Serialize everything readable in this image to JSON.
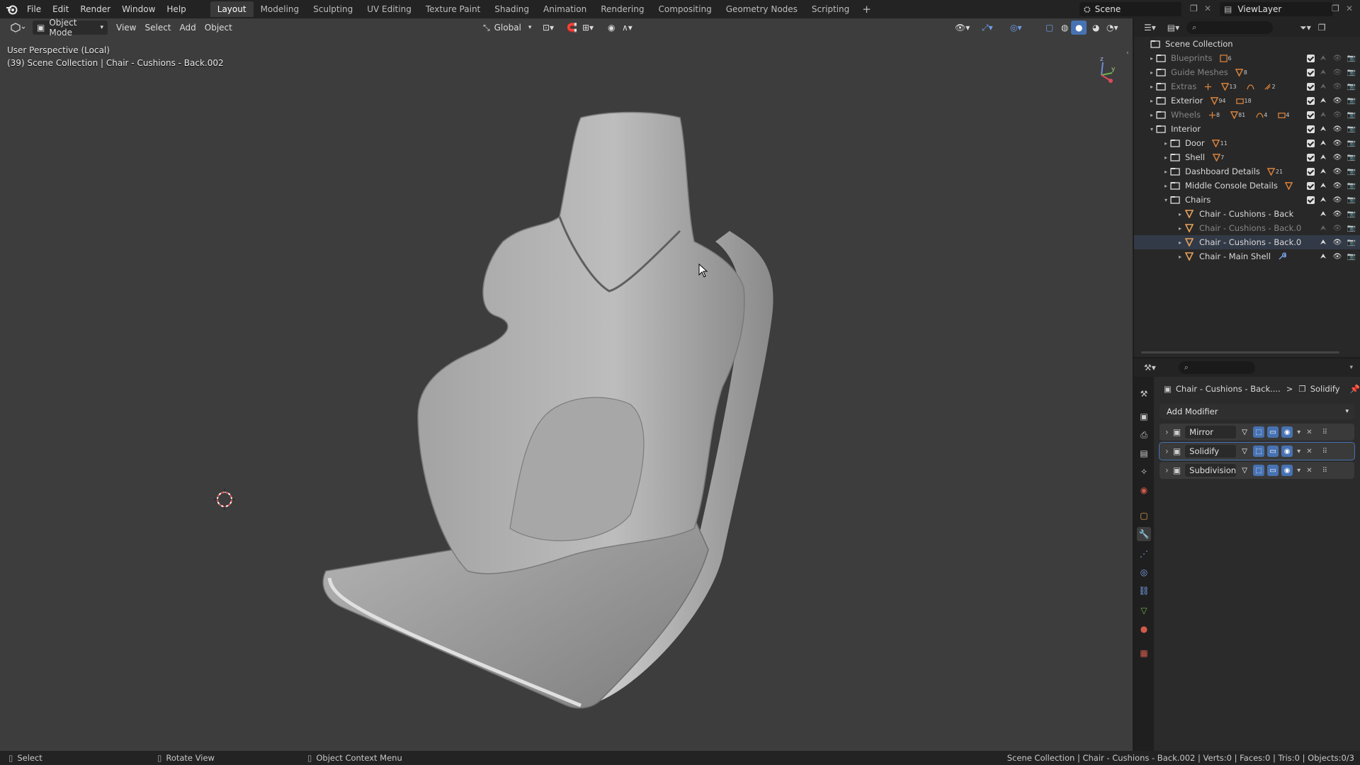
{
  "top_menu": {
    "items": [
      "File",
      "Edit",
      "Render",
      "Window",
      "Help"
    ],
    "workspaces": [
      "Layout",
      "Modeling",
      "Sculpting",
      "UV Editing",
      "Texture Paint",
      "Shading",
      "Animation",
      "Rendering",
      "Compositing",
      "Geometry Nodes",
      "Scripting"
    ],
    "active_workspace": "Layout",
    "add_label": "+",
    "scene_name": "Scene",
    "view_layer": "ViewLayer"
  },
  "viewport": {
    "mode_label": "Object Mode",
    "menus": [
      "View",
      "Select",
      "Add",
      "Object"
    ],
    "orientation": "Global",
    "info_line1": "User Perspective (Local)",
    "info_line2": "(39) Scene Collection | Chair - Cushions - Back.002",
    "gizmo_axes": {
      "z": "z",
      "y": "y",
      "x": "x"
    }
  },
  "outliner": {
    "root": "Scene Collection",
    "rows": [
      {
        "label": "Blueprints",
        "level": 1,
        "dim": true,
        "arrow": "▸",
        "icon": "collection-icon",
        "badges": [
          {
            "icon": "image-icon",
            "count": "6"
          }
        ]
      },
      {
        "label": "Guide Meshes",
        "level": 1,
        "dim": true,
        "arrow": "▸",
        "icon": "collection-icon",
        "badges": [
          {
            "icon": "mesh-icon",
            "count": "8"
          }
        ]
      },
      {
        "label": "Extras",
        "level": 1,
        "dim": true,
        "arrow": "▸",
        "icon": "collection-icon",
        "badges": [
          {
            "icon": "empty-icon",
            "count": ""
          },
          {
            "icon": "mesh-icon",
            "count": "13"
          },
          {
            "icon": "curve-icon",
            "count": ""
          },
          {
            "icon": "particles-icon",
            "count": "2"
          }
        ]
      },
      {
        "label": "Exterior",
        "level": 1,
        "dim": false,
        "arrow": "▸",
        "icon": "collection-icon",
        "badges": [
          {
            "icon": "mesh-icon",
            "count": "94"
          },
          {
            "icon": "light-icon",
            "count": "18"
          }
        ]
      },
      {
        "label": "Wheels",
        "level": 1,
        "dim": true,
        "arrow": "▸",
        "icon": "collection-icon",
        "badges": [
          {
            "icon": "empty-icon",
            "count": "8"
          },
          {
            "icon": "mesh-icon",
            "count": "81"
          },
          {
            "icon": "curve-icon",
            "count": "4"
          },
          {
            "icon": "light-icon",
            "count": "4"
          }
        ]
      },
      {
        "label": "Interior",
        "level": 1,
        "dim": false,
        "arrow": "▾",
        "icon": "collection-icon",
        "badges": []
      },
      {
        "label": "Door",
        "level": 2,
        "dim": false,
        "arrow": "▸",
        "icon": "collection-icon",
        "badges": [
          {
            "icon": "mesh-icon",
            "count": "11"
          }
        ]
      },
      {
        "label": "Shell",
        "level": 2,
        "dim": false,
        "arrow": "▸",
        "icon": "collection-icon",
        "badges": [
          {
            "icon": "mesh-icon",
            "count": "7"
          }
        ]
      },
      {
        "label": "Dashboard Details",
        "level": 2,
        "dim": false,
        "arrow": "▸",
        "icon": "collection-icon",
        "badges": [
          {
            "icon": "mesh-icon",
            "count": "21"
          }
        ]
      },
      {
        "label": "Middle Console Details",
        "level": 2,
        "dim": false,
        "arrow": "▸",
        "icon": "collection-icon",
        "badges": [
          {
            "icon": "mesh-icon",
            "count": ""
          }
        ]
      },
      {
        "label": "Chairs",
        "level": 2,
        "dim": false,
        "arrow": "▾",
        "icon": "collection-icon",
        "badges": []
      },
      {
        "label": "Chair - Cushions - Back",
        "level": 3,
        "dim": false,
        "arrow": "▸",
        "icon": "mesh-object-icon",
        "badges": []
      },
      {
        "label": "Chair - Cushions - Back.0",
        "level": 3,
        "dim": true,
        "arrow": "▸",
        "icon": "mesh-object-icon",
        "badges": []
      },
      {
        "label": "Chair - Cushions - Back.0",
        "level": 3,
        "dim": false,
        "arrow": "▸",
        "icon": "mesh-object-icon",
        "badges": [],
        "active": true
      },
      {
        "label": "Chair - Main Shell",
        "level": 3,
        "dim": false,
        "arrow": "▸",
        "icon": "mesh-object-icon",
        "badges": [
          {
            "icon": "wrench-icon",
            "count": ""
          }
        ]
      }
    ]
  },
  "properties": {
    "breadcrumb_object": "Chair - Cushions - Back....",
    "breadcrumb_sep": ">",
    "breadcrumb_modifier": "Solidify",
    "add_modifier_label": "Add Modifier",
    "modifiers": [
      {
        "name": "Mirror",
        "icon": "mirror-icon"
      },
      {
        "name": "Solidify",
        "icon": "solidify-icon",
        "selected": true
      },
      {
        "name": "Subdivision",
        "icon": "subdivision-icon"
      }
    ]
  },
  "statusbar": {
    "left": [
      {
        "icon": "mouse-left-icon",
        "label": "Select"
      },
      {
        "icon": "mouse-middle-icon",
        "label": "Rotate View"
      },
      {
        "icon": "mouse-right-icon",
        "label": "Object Context Menu"
      }
    ],
    "right": "Scene Collection | Chair - Cushions - Back.002 | Verts:0 | Faces:0 | Tris:0 | Objects:0/3"
  },
  "colors": {
    "accent": "#4772b3",
    "viewport_bg": "#3d3d3d",
    "panel_bg": "#282828",
    "mesh_icon": "#e8a35a",
    "mesh_badge": "#d9823b"
  }
}
